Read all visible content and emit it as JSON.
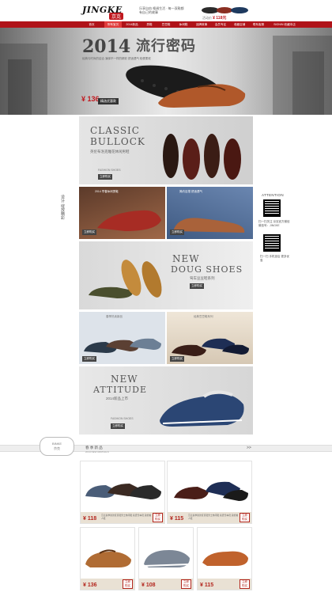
{
  "header": {
    "logo": "JINGKE",
    "logo_cn": "京克",
    "slogan": "乐享自由 格调生活 · 每一双鞋都有自己的故事",
    "top_promo_price_prefix": "活动价",
    "top_promo_price": "¥ 118元"
  },
  "nav": [
    "首页",
    "所有宝贝",
    "2014新品",
    "男鞋",
    "豆豆鞋",
    "休闲鞋",
    "品牌故事",
    "会员专区",
    "收藏店铺",
    "联系客服",
    "SIGNIN 收藏本店"
  ],
  "hero": {
    "year": "2014",
    "title": "流行密码",
    "subtitle": "经典与时尚的结合 演绎不一样的精彩 舒适透气 轻便柔软",
    "price": "¥ 136",
    "tag": "精选优惠款"
  },
  "collage": {
    "classic_title1": "CLASSIC",
    "classic_title2": "BULLOCK",
    "classic_cn": "英伦布洛克雕花休闲男鞋",
    "fashion": "FASHION SHOES",
    "left_panel_label": "2014 早春休闲男鞋",
    "right_panel_label": "简约百搭 舒适透气",
    "doug_title1": "NEW",
    "doug_title2": "DOUG SHOES",
    "doug_cn": "驾车豆豆鞋系列",
    "row3_left": "春季热卖新品",
    "row3_right": "经典豆豆鞋系列",
    "attitude_title1": "NEW",
    "attitude_title2": "ATTITUDE",
    "attitude_cn": "2014新品上市",
    "side_text": "设计 绽放精彩",
    "btn_label": "立即购买"
  },
  "sidebar": {
    "attention": "ATTENTION",
    "qr1_text": "扫一扫关注 京克官方微信 微信号：JINGKE",
    "qr2_text": "扫一扫 手机逛店 更多优惠"
  },
  "divider": {
    "badge": "BINKE",
    "badge_cn": "京克",
    "title": "春 季 新 品",
    "subtitle": "2014 NEW ARRIVALS",
    "arrow": ">>"
  },
  "products": [
    {
      "price": "¥ 118",
      "desc": "京克春季新款豆豆鞋男士休闲鞋 真皮驾车鞋 英伦懒人鞋",
      "buy": "立即 购买"
    },
    {
      "price": "¥ 115",
      "desc": "京克春季新款豆豆鞋男士休闲鞋 真皮驾车鞋 英伦懒人鞋",
      "buy": "立即 购买"
    },
    {
      "price": "¥ 136",
      "desc": "京克男鞋 真皮休闲鞋 系带",
      "buy": "立即 购买"
    },
    {
      "price": "¥ 108",
      "desc": "京克男鞋 帆布休闲鞋",
      "buy": "立即 购买"
    },
    {
      "price": "¥ 115",
      "desc": "京克男鞋 豆豆鞋",
      "buy": "立即 购买"
    }
  ],
  "colors": {
    "brand_red": "#b01319",
    "price_red": "#b3261e",
    "bar_beige": "#e9e1d4"
  }
}
